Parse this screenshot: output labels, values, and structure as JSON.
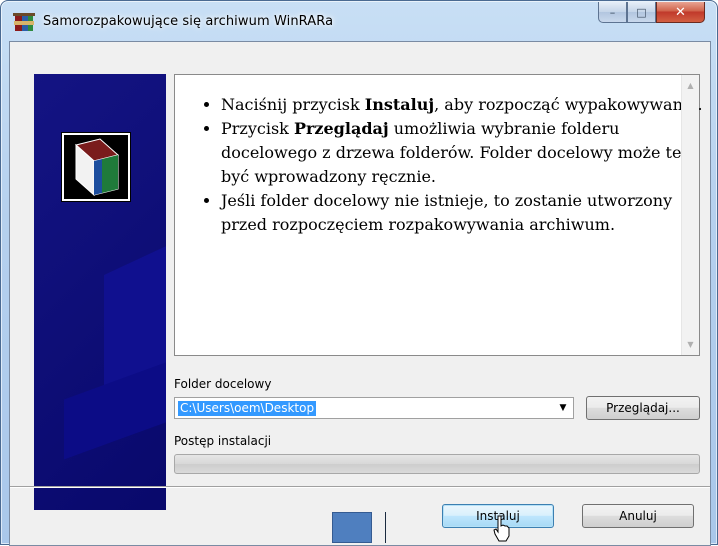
{
  "window": {
    "title": "Samorozpakowujące się archiwum WinRARa",
    "minimize_glyph": "–",
    "maximize_glyph": "□",
    "close_glyph": "✕"
  },
  "info": {
    "bullets": [
      {
        "before": "Naciśnij przycisk ",
        "bold": "Instaluj",
        "after": ", aby rozpocząć wypakowywanie."
      },
      {
        "before": "Przycisk ",
        "bold": "Przeglądaj",
        "after": " umożliwia wybranie folderu docelowego z drzewa folderów. Folder docelowy może też być wprowadzony ręcznie."
      },
      {
        "before": "Jeśli folder docelowy nie istnieje, to zostanie utworzony przed rozpoczęciem rozpakowywania archiwum.",
        "bold": "",
        "after": ""
      }
    ]
  },
  "folder": {
    "label": "Folder docelowy",
    "value": "C:\\Users\\oem\\Desktop",
    "browse_label": "Przeglądaj..."
  },
  "progress": {
    "label": "Postęp instalacji",
    "value": 0
  },
  "buttons": {
    "install_label": "Instaluj",
    "cancel_label": "Anuluj"
  },
  "icons": {
    "app": "winrar-icon",
    "logo": "rar-archive-icon",
    "cursor": "hand-cursor-icon"
  },
  "colors": {
    "side_panel": "#0a0a7e",
    "selection": "#3399ff",
    "close_button": "#c0392b"
  }
}
